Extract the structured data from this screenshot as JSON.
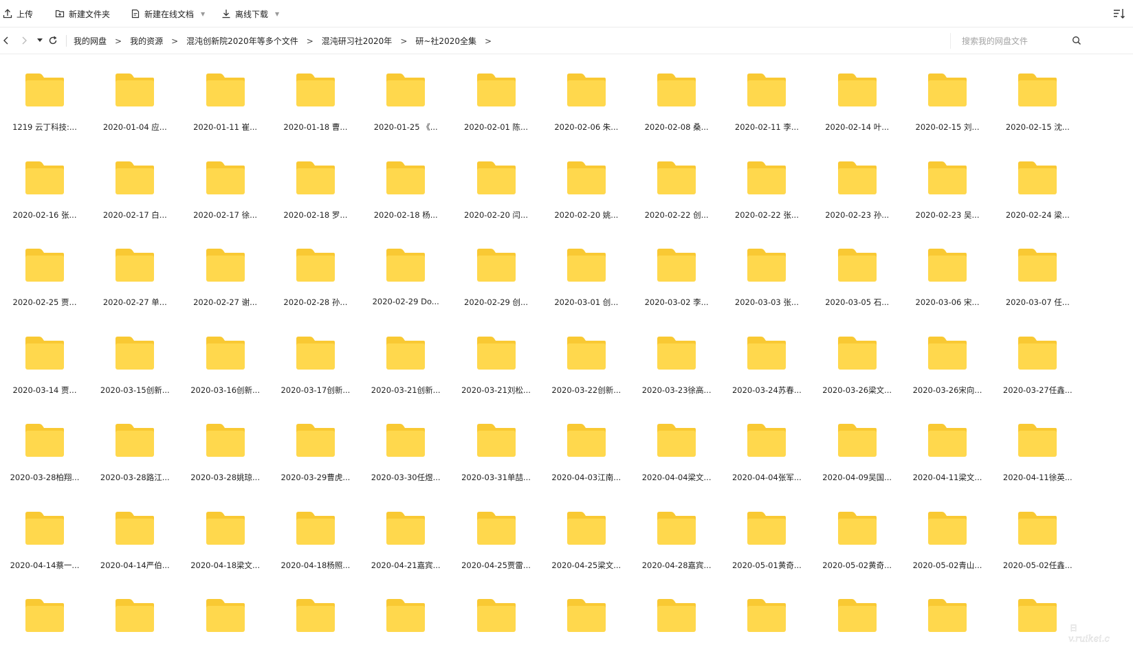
{
  "toolbar": {
    "upload": "上传",
    "new_folder": "新建文件夹",
    "new_online_doc": "新建在线文档",
    "offline_download": "离线下载"
  },
  "breadcrumb": [
    "我的网盘",
    "我的资源",
    "混沌创新院2020年等多个文件",
    "混沌研习社2020年",
    "研~社2020全集"
  ],
  "search": {
    "placeholder": "搜索我的网盘文件"
  },
  "folders": [
    "1219 云丁科技:...",
    "2020-01-04 应...",
    "2020-01-11 崔...",
    "2020-01-18 曹...",
    "2020-01-25 《...",
    "2020-02-01 陈...",
    "2020-02-06 朱...",
    "2020-02-08 桑...",
    "2020-02-11 李...",
    "2020-02-14 叶...",
    "2020-02-15 刘...",
    "2020-02-15 沈...",
    "2020-02-16 张...",
    "2020-02-17 白...",
    "2020-02-17 徐...",
    "2020-02-18 罗...",
    "2020-02-18 杨...",
    "2020-02-20 闫...",
    "2020-02-20 姚...",
    "2020-02-22 创...",
    "2020-02-22 张...",
    "2020-02-23 孙...",
    "2020-02-23 吴...",
    "2020-02-24 梁...",
    "2020-02-25 贾...",
    "2020-02-27 单...",
    "2020-02-27 谢...",
    "2020-02-28 孙...",
    "2020-02-29 Do...",
    "2020-02-29 创...",
    "2020-03-01 创...",
    "2020-03-02 李...",
    "2020-03-03 张...",
    "2020-03-05 石...",
    "2020-03-06 宋...",
    "2020-03-07 任...",
    "2020-03-14 贾...",
    "2020-03-15创新...",
    "2020-03-16创新...",
    "2020-03-17创新...",
    "2020-03-21创新...",
    "2020-03-21刘松...",
    "2020-03-22创新...",
    "2020-03-23徐高...",
    "2020-03-24苏春...",
    "2020-03-26梁文...",
    "2020-03-26宋向...",
    "2020-03-27任鑫...",
    "2020-03-28柏翔...",
    "2020-03-28路江...",
    "2020-03-28姚琼...",
    "2020-03-29曹虎...",
    "2020-03-30任煜...",
    "2020-03-31单喆...",
    "2020-04-03江南...",
    "2020-04-04梁文...",
    "2020-04-04张军...",
    "2020-04-09吴国...",
    "2020-04-11梁文...",
    "2020-04-11徐英...",
    "2020-04-14蔡一...",
    "2020-04-14严伯...",
    "2020-04-18梁文...",
    "2020-04-18杨照...",
    "2020-04-21嘉宾...",
    "2020-04-25贾雷...",
    "2020-04-25梁文...",
    "2020-04-28嘉宾...",
    "2020-05-01黄奇...",
    "2020-05-02黄奇...",
    "2020-05-02青山...",
    "2020-05-02任鑫...",
    "",
    "",
    "",
    "",
    "",
    "",
    "",
    "",
    "",
    "",
    "",
    ""
  ],
  "folder_color": "#FFD84D",
  "folder_tab_color": "#F9C933"
}
